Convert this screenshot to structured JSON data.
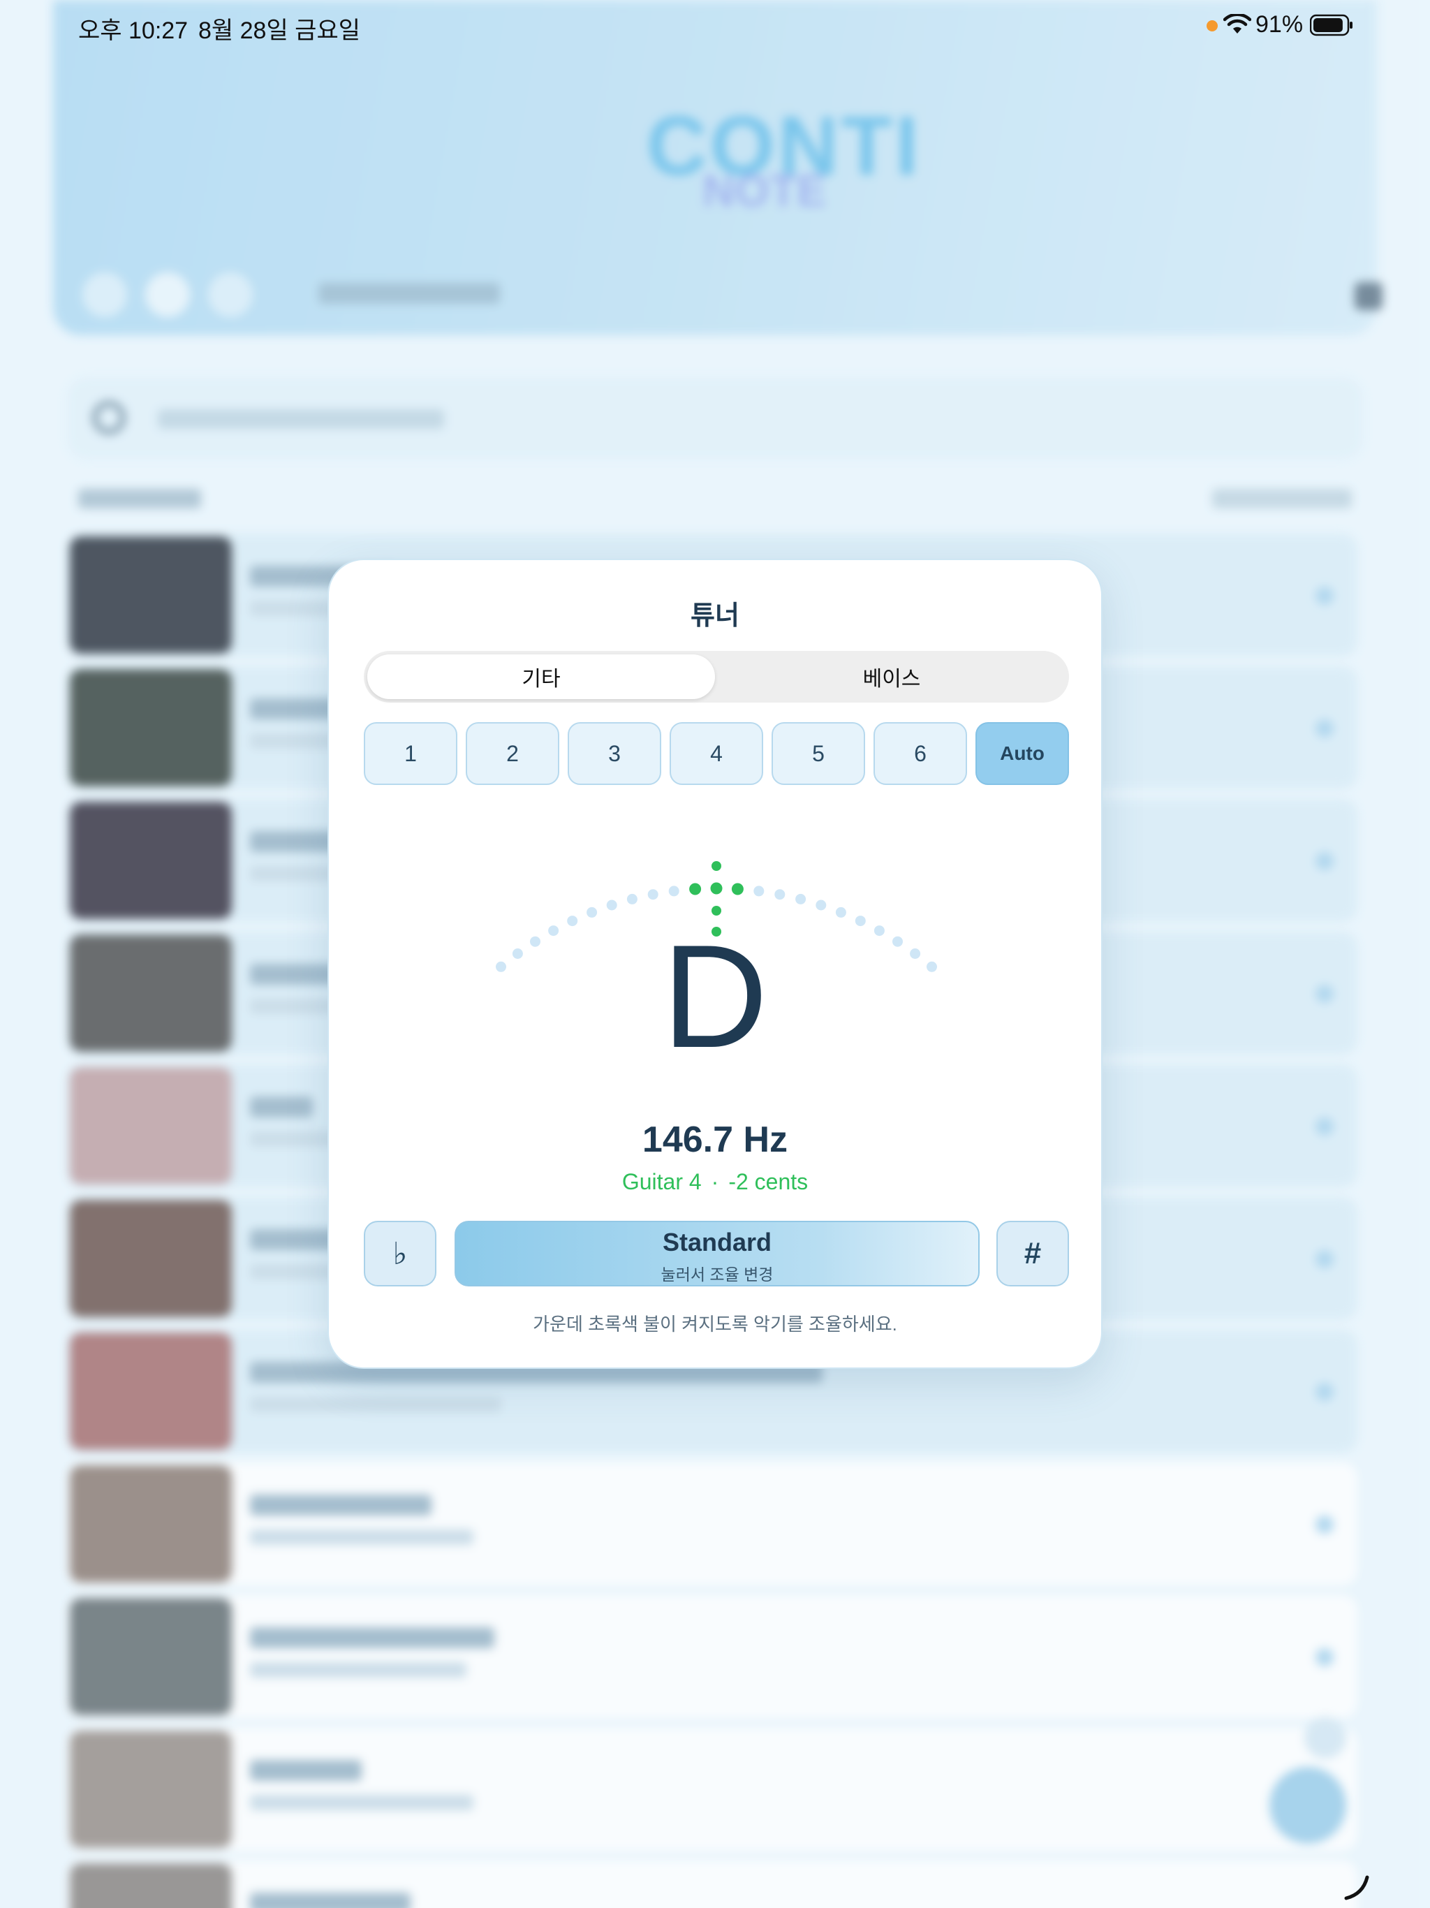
{
  "status_bar": {
    "time": "오후 10:27",
    "date": "8월 28일 금요일",
    "battery_percent": "91%",
    "battery_level": 0.91,
    "mic_indicator_color": "#f59a2e"
  },
  "background_app": {
    "logo_main": "CONTI",
    "logo_sub": "NOTE",
    "accent_color": "#4fb4e6"
  },
  "tuner": {
    "title": "튜너",
    "instrument_tabs": [
      {
        "label": "기타",
        "selected": true
      },
      {
        "label": "베이스",
        "selected": false
      }
    ],
    "strings": [
      {
        "label": "1",
        "selected": false
      },
      {
        "label": "2",
        "selected": false
      },
      {
        "label": "3",
        "selected": false
      },
      {
        "label": "4",
        "selected": false
      },
      {
        "label": "5",
        "selected": false
      },
      {
        "label": "6",
        "selected": false
      },
      {
        "label": "Auto",
        "selected": true
      }
    ],
    "note": "D",
    "frequency": "146.7 Hz",
    "string_info": "Guitar 4",
    "separator": "·",
    "cents": "-2 cents",
    "cents_value": -2,
    "in_tune_color": "#2fbf5a",
    "meter_dot_color": "#cfe6f6",
    "flat_label": "♭",
    "sharp_label": "#",
    "tuning_name": "Standard",
    "tuning_hint": "눌러서 조율 변경",
    "footer_hint": "가운데 초록색 불이 켜지도록 악기를 조율하세요."
  }
}
